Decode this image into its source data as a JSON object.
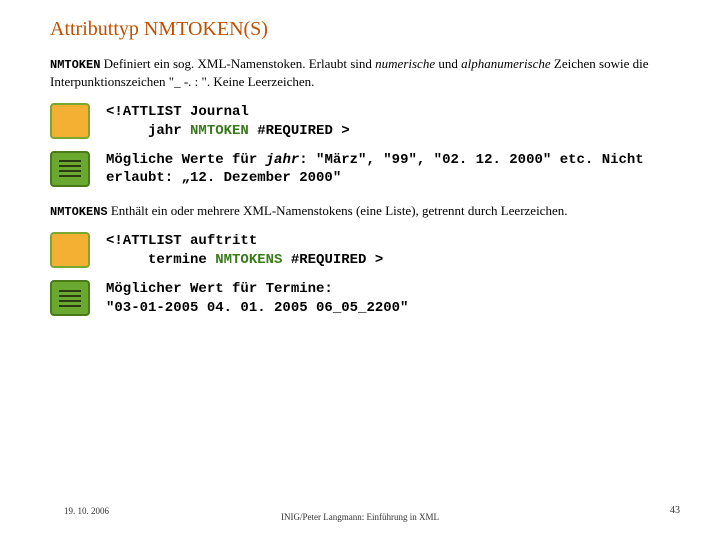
{
  "title": "Attributtyp NMTOKEN(S)",
  "p1": {
    "kw": "NMTOKEN",
    "t1": " Definiert ein sog. XML-Namenstoken. Erlaubt sind ",
    "i1": "numerische",
    "t2": " und ",
    "i2": "alphanumerische",
    "t3": " Zeichen sowie die Interpunktionszeichen \"_ -. : \". Keine Leerzeichen."
  },
  "code1": {
    "l1a": "<!ATTLIST Journal",
    "l2a": "     jahr ",
    "l2b": "NMTOKEN",
    "l2c": " #REQUIRED >"
  },
  "note1": {
    "a": "Mögliche Werte für ",
    "b": "jahr",
    "c": ": \"März\", \"99\", \"02. 12. 2000\" etc. Nicht erlaubt: „12. Dezember 2000\""
  },
  "p2": {
    "kw": "NMTOKENS",
    "t1": " Enthält ein oder mehrere XML-Namenstokens (eine Liste), getrennt durch Leerzeichen."
  },
  "code2": {
    "l1a": "<!ATTLIST auftritt",
    "l2a": "     termine ",
    "l2b": "NMTOKENS",
    "l2c": " #REQUIRED >"
  },
  "note2": "Möglicher Wert für Termine:\n\"03-01-2005 04. 01. 2005 06_05_2200\"",
  "footer": {
    "date": "19. 10. 2006",
    "center": "INIG/Peter Langmann: Einführung in XML",
    "page": "43"
  }
}
